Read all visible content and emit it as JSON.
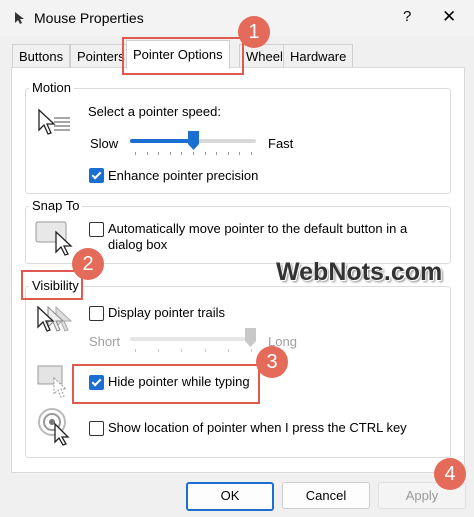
{
  "window": {
    "title": "Mouse Properties",
    "help": "?",
    "close": "✕"
  },
  "tabs": [
    {
      "label": "Buttons"
    },
    {
      "label": "Pointers"
    },
    {
      "label": "Pointer Options"
    },
    {
      "label": "Wheel"
    },
    {
      "label": "Hardware"
    }
  ],
  "motion": {
    "legend": "Motion",
    "speed_label": "Select a pointer speed:",
    "slow": "Slow",
    "fast": "Fast",
    "speed_value": 0.5,
    "enhance_label": "Enhance pointer precision",
    "enhance_checked": true
  },
  "snap_to": {
    "legend": "Snap To",
    "auto_move_label_line1": "Automatically move pointer to the default button in a",
    "auto_move_label_line2": "dialog box",
    "auto_move_checked": false
  },
  "visibility": {
    "legend": "Visibility",
    "trails_label": "Display pointer trails",
    "trails_checked": false,
    "short": "Short",
    "long": "Long",
    "trail_value": 1.0,
    "hide_typing_label": "Hide pointer while typing",
    "hide_typing_checked": true,
    "show_location_label": "Show location of pointer when I press the CTRL key",
    "show_location_checked": false
  },
  "buttons": {
    "ok": "OK",
    "cancel": "Cancel",
    "apply": "Apply"
  },
  "annotations": {
    "badges": [
      "1",
      "2",
      "3",
      "4"
    ],
    "watermark": "WebNots.com",
    "highlight_color": "#e05a4e",
    "badge_color": "#e46a5a"
  },
  "colors": {
    "accent": "#1a6fd0"
  }
}
